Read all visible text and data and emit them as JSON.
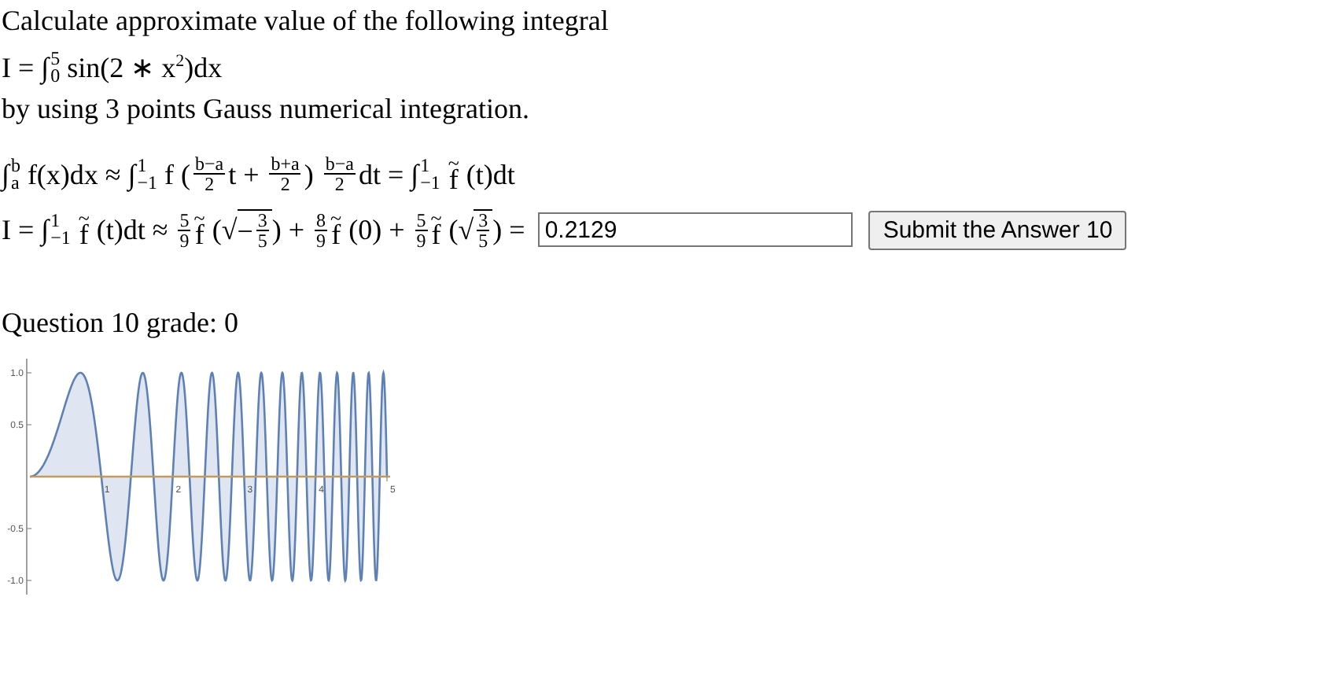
{
  "intro": [
    [
      {
        "kind": "text",
        "text": "Calculate approximate value of the following integral"
      }
    ],
    [
      {
        "kind": "text",
        "text": "I = "
      },
      {
        "kind": "int",
        "sign": "∫",
        "lower": "0",
        "upper": "5"
      },
      {
        "kind": "text",
        "text": " sin(2 ∗ x"
      },
      {
        "kind": "sup",
        "text": "2"
      },
      {
        "kind": "text",
        "text": ")dx"
      }
    ],
    [
      {
        "kind": "text",
        "text": "by using 3 points Gauss numerical integration."
      }
    ]
  ],
  "formula_1": [
    {
      "kind": "int",
      "sign": "∫",
      "lower": "a",
      "upper": "b"
    },
    {
      "kind": "text",
      "text": " f(x)dx ≈ "
    },
    {
      "kind": "int",
      "sign": "∫",
      "lower": "−1",
      "upper": "1"
    },
    {
      "kind": "text",
      "text": " f ("
    },
    {
      "kind": "frac",
      "num": "b−a",
      "den": "2"
    },
    {
      "kind": "text",
      "text": "t + "
    },
    {
      "kind": "frac",
      "num": "b+a",
      "den": "2"
    },
    {
      "kind": "text",
      "text": ") "
    },
    {
      "kind": "frac",
      "num": "b−a",
      "den": "2"
    },
    {
      "kind": "text",
      "text": "dt = "
    },
    {
      "kind": "int",
      "sign": "∫",
      "lower": "−1",
      "upper": "1"
    },
    {
      "kind": "tilde",
      "base": "f",
      "mark": "~"
    },
    {
      "kind": "text",
      "text": " (t)dt"
    }
  ],
  "formula_2": [
    {
      "kind": "text",
      "text": "I = "
    },
    {
      "kind": "int",
      "sign": "∫",
      "lower": "−1",
      "upper": "1"
    },
    {
      "kind": "tilde",
      "base": "f",
      "mark": "~"
    },
    {
      "kind": "text",
      "text": " (t)dt ≈ "
    },
    {
      "kind": "frac",
      "num": "5",
      "den": "9"
    },
    {
      "kind": "tilde",
      "base": "f",
      "mark": "~"
    },
    {
      "kind": "text",
      "text": " ("
    },
    {
      "kind": "sqrt",
      "sign": "√",
      "children": [
        {
          "kind": "text",
          "text": "−"
        },
        {
          "kind": "frac",
          "num": "3",
          "den": "5"
        }
      ]
    },
    {
      "kind": "text",
      "text": ") + "
    },
    {
      "kind": "frac",
      "num": "8",
      "den": "9"
    },
    {
      "kind": "tilde",
      "base": "f",
      "mark": "~"
    },
    {
      "kind": "text",
      "text": " (0) + "
    },
    {
      "kind": "frac",
      "num": "5",
      "den": "9"
    },
    {
      "kind": "tilde",
      "base": "f",
      "mark": "~"
    },
    {
      "kind": "text",
      "text": " ("
    },
    {
      "kind": "sqrt",
      "sign": "√",
      "children": [
        {
          "kind": "frac",
          "num": "3",
          "den": "5"
        }
      ]
    },
    {
      "kind": "text",
      "text": ") = "
    }
  ],
  "answer": {
    "value": "0.2129"
  },
  "submit_button": {
    "label": "Submit the Answer 10"
  },
  "grade": "Question 10 grade: 0",
  "plot": {
    "xticks": [
      "1",
      "2",
      "3",
      "4",
      "5"
    ],
    "yticks": [
      "1.0",
      "0.5",
      "-0.5",
      "-1.0"
    ]
  }
}
